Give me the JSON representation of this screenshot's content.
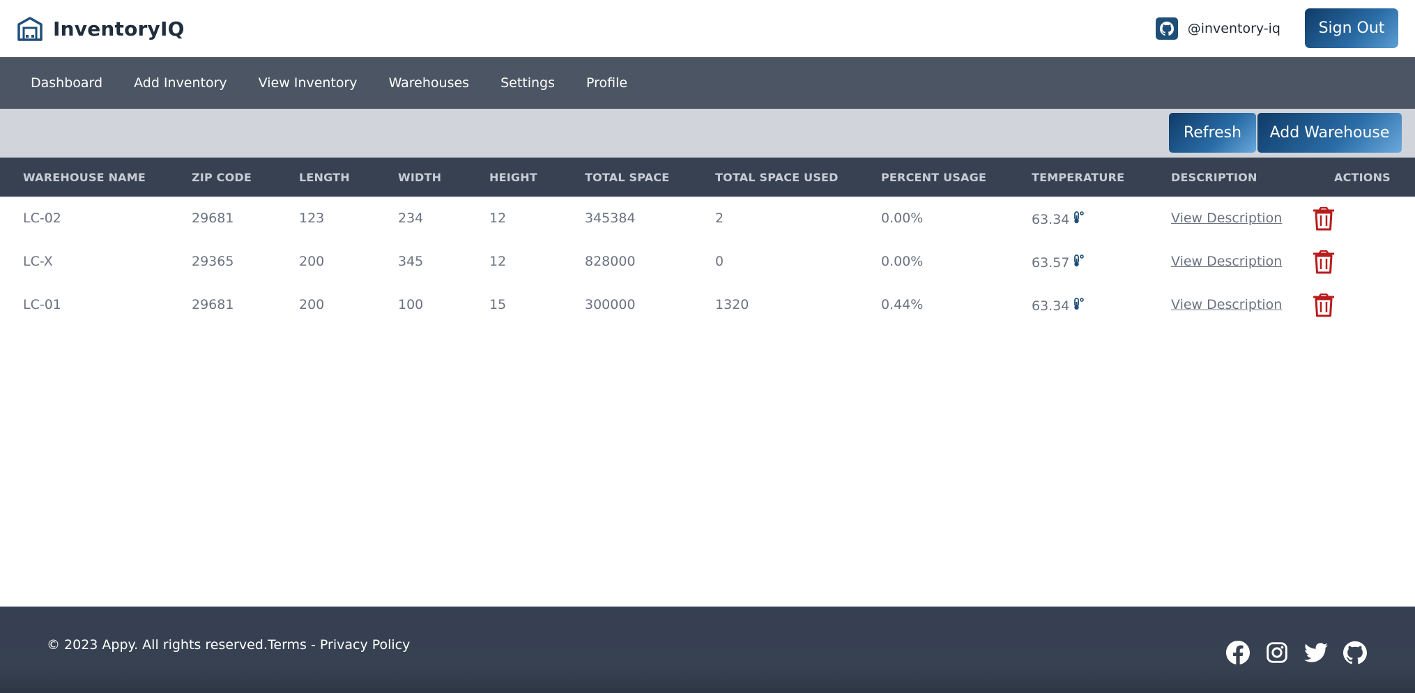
{
  "header": {
    "brand_name": "InventoryIQ",
    "brand_icon": "warehouse-icon",
    "github_handle": "@inventory-iq",
    "signout_label": "Sign Out"
  },
  "nav": {
    "items": [
      {
        "label": "Dashboard"
      },
      {
        "label": "Add Inventory"
      },
      {
        "label": "View Inventory"
      },
      {
        "label": "Warehouses"
      },
      {
        "label": "Settings"
      },
      {
        "label": "Profile"
      }
    ]
  },
  "toolbar": {
    "refresh_label": "Refresh",
    "add_warehouse_label": "Add Warehouse"
  },
  "table": {
    "headers": [
      "WAREHOUSE NAME",
      "ZIP CODE",
      "LENGTH",
      "WIDTH",
      "HEIGHT",
      "TOTAL SPACE",
      "TOTAL SPACE USED",
      "PERCENT USAGE",
      "TEMPERATURE",
      "DESCRIPTION",
      "ACTIONS"
    ],
    "rows": [
      {
        "name": "LC-02",
        "zip": "29681",
        "length": "123",
        "width": "234",
        "height": "12",
        "total_space": "345384",
        "space_used": "2",
        "percent": "0.00%",
        "temperature": "63.34",
        "description": "View Description"
      },
      {
        "name": "LC-X",
        "zip": "29365",
        "length": "200",
        "width": "345",
        "height": "12",
        "total_space": "828000",
        "space_used": "0",
        "percent": "0.00%",
        "temperature": "63.57",
        "description": "View Description"
      },
      {
        "name": "LC-01",
        "zip": "29681",
        "length": "200",
        "width": "100",
        "height": "15",
        "total_space": "300000",
        "space_used": "1320",
        "percent": "0.44%",
        "temperature": "63.34",
        "description": "View Description"
      }
    ]
  },
  "footer": {
    "copyright": "© 2023 Appy. All rights reserved.",
    "terms": "Terms",
    "separator": " - ",
    "privacy": "Privacy Policy",
    "social_icons": [
      "facebook-icon",
      "instagram-icon",
      "twitter-icon",
      "github-icon"
    ]
  },
  "colors": {
    "primary": "#1f4e79",
    "nav_bg": "#4b5563",
    "toolbar_bg": "#d1d5db",
    "table_head_bg": "#374151",
    "danger": "#b91c1c",
    "footer_bg": "#374151"
  }
}
